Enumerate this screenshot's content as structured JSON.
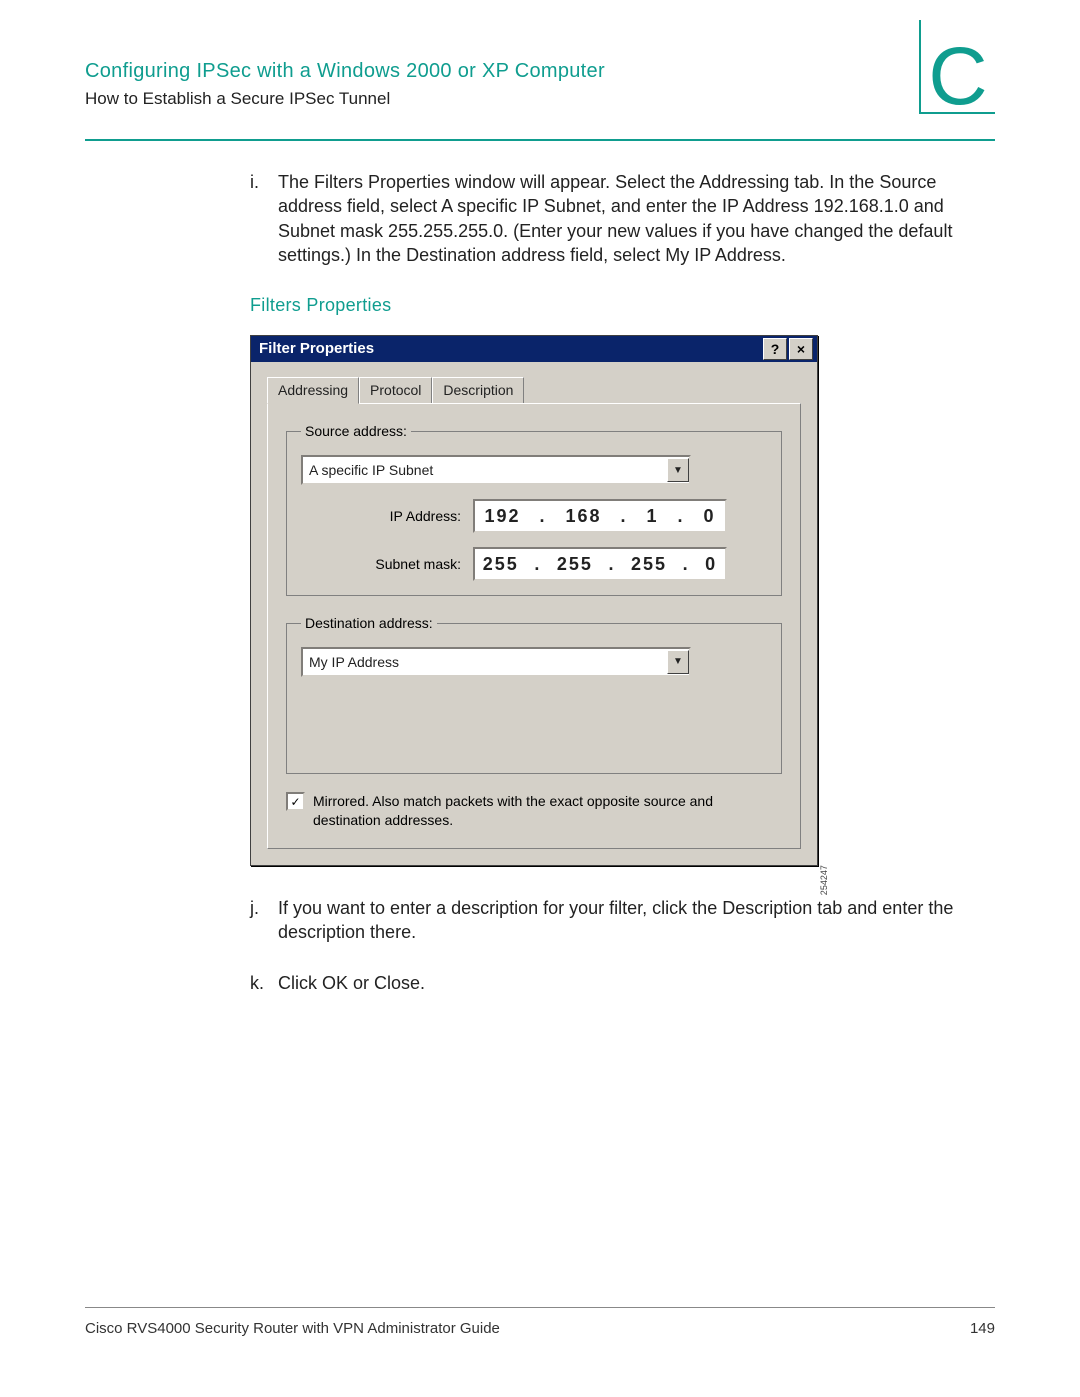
{
  "header": {
    "title": "Configuring IPSec with a Windows 2000 or XP Computer",
    "subtitle": "How to Establish a Secure IPSec Tunnel",
    "appendix_letter": "C"
  },
  "steps": {
    "i": {
      "marker": "i.",
      "text": "The Filters Properties window will appear. Select the Addressing tab. In the Source address field, select A specific IP Subnet, and enter the IP Address 192.168.1.0 and Subnet mask 255.255.255.0. (Enter your new values if you have changed the default settings.) In the Destination address field, select My IP Address."
    },
    "j": {
      "marker": "j.",
      "text": "If you want to enter a description for your filter, click the Description tab and enter the description there."
    },
    "k": {
      "marker": "k.",
      "text": "Click OK or Close."
    }
  },
  "figure": {
    "label": "Filters Properties",
    "side_code": "254247"
  },
  "dialog": {
    "title": "Filter Properties",
    "help_glyph": "?",
    "close_glyph": "×",
    "tabs": [
      "Addressing",
      "Protocol",
      "Description"
    ],
    "source": {
      "legend": "Source address:",
      "dropdown_value": "A specific IP Subnet",
      "ip_label": "IP Address:",
      "ip_value": [
        "192",
        "168",
        "1",
        "0"
      ],
      "mask_label": "Subnet mask:",
      "mask_value": [
        "255",
        "255",
        "255",
        "0"
      ]
    },
    "destination": {
      "legend": "Destination address:",
      "dropdown_value": "My IP Address"
    },
    "mirrored": {
      "checked_glyph": "✓",
      "text": "Mirrored. Also match packets with the exact opposite source and destination addresses."
    }
  },
  "footer": {
    "left": "Cisco RVS4000 Security Router with VPN Administrator Guide",
    "page": "149"
  }
}
